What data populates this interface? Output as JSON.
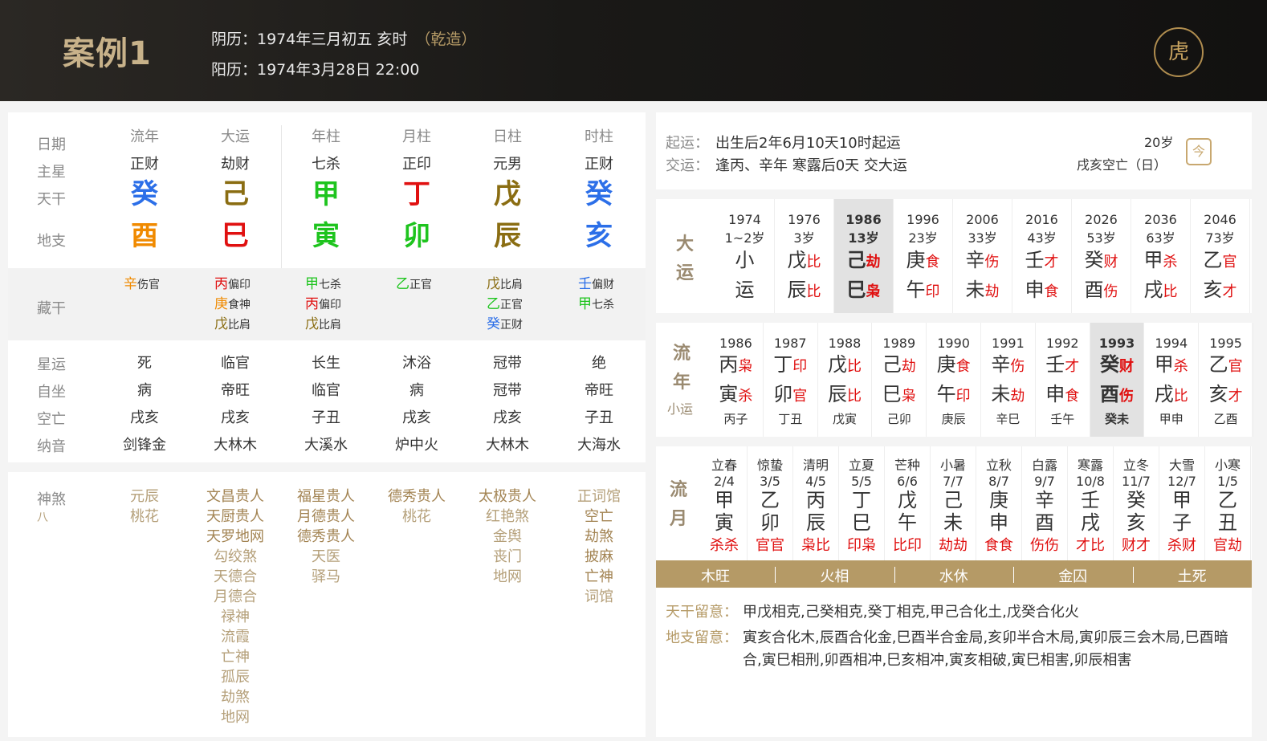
{
  "header": {
    "title": "案例1",
    "lunar": "阴历：1974年三月初五 亥时",
    "gender": "（乾造）",
    "solar": "阳历：1974年3月28日 22:00",
    "logo_icon": "tiger-seal-icon"
  },
  "pillars": {
    "col_headers": [
      "流年",
      "大运",
      "年柱",
      "月柱",
      "日柱",
      "时柱"
    ],
    "row_labels": {
      "date": "日期",
      "main_star": "主星",
      "tiangan": "天干",
      "dizhi": "地支",
      "canggan": "藏干",
      "xingyun": "星运",
      "zizuo": "自坐",
      "kongwang": "空亡",
      "nayin": "纳音",
      "shensha": "神煞",
      "shensha_sub": "八"
    },
    "main_star": [
      "正财",
      "劫财",
      "七杀",
      "正印",
      "元男",
      "正财"
    ],
    "tiangan": [
      {
        "char": "癸",
        "color": "#2c6fe8"
      },
      {
        "char": "己",
        "color": "#8a6d12"
      },
      {
        "char": "甲",
        "color": "#1ec41e"
      },
      {
        "char": "丁",
        "color": "#e01010"
      },
      {
        "char": "戊",
        "color": "#8a6d12"
      },
      {
        "char": "癸",
        "color": "#2c6fe8"
      }
    ],
    "dizhi": [
      {
        "char": "酉",
        "color": "#f08a00"
      },
      {
        "char": "巳",
        "color": "#e01010"
      },
      {
        "char": "寅",
        "color": "#1ec41e"
      },
      {
        "char": "卯",
        "color": "#1ec41e"
      },
      {
        "char": "辰",
        "color": "#8a6d12"
      },
      {
        "char": "亥",
        "color": "#2c6fe8"
      }
    ],
    "canggan": [
      [
        {
          "g": "辛",
          "c": "#f08a00",
          "s": "伤官"
        }
      ],
      [
        {
          "g": "丙",
          "c": "#e01010",
          "s": "偏印"
        },
        {
          "g": "庚",
          "c": "#f08a00",
          "s": "食神"
        },
        {
          "g": "戊",
          "c": "#8a6d12",
          "s": "比肩"
        }
      ],
      [
        {
          "g": "甲",
          "c": "#1ec41e",
          "s": "七杀"
        },
        {
          "g": "丙",
          "c": "#e01010",
          "s": "偏印"
        },
        {
          "g": "戊",
          "c": "#8a6d12",
          "s": "比肩"
        }
      ],
      [
        {
          "g": "乙",
          "c": "#1ec41e",
          "s": "正官"
        }
      ],
      [
        {
          "g": "戊",
          "c": "#8a6d12",
          "s": "比肩"
        },
        {
          "g": "乙",
          "c": "#1ec41e",
          "s": "正官"
        },
        {
          "g": "癸",
          "c": "#2c6fe8",
          "s": "正财"
        }
      ],
      [
        {
          "g": "壬",
          "c": "#2c6fe8",
          "s": "偏财"
        },
        {
          "g": "甲",
          "c": "#1ec41e",
          "s": "七杀"
        }
      ]
    ],
    "xingyun": [
      "死",
      "临官",
      "长生",
      "沐浴",
      "冠带",
      "绝"
    ],
    "zizuo": [
      "病",
      "帝旺",
      "临官",
      "病",
      "冠带",
      "帝旺"
    ],
    "kongwang": [
      "戌亥",
      "戌亥",
      "子丑",
      "戌亥",
      "戌亥",
      "子丑"
    ],
    "nayin": [
      "剑锋金",
      "大林木",
      "大溪水",
      "炉中火",
      "大林木",
      "大海水"
    ],
    "shensha": [
      [
        "元辰",
        "桃花"
      ],
      [
        "文昌贵人",
        "天厨贵人",
        "天罗地网",
        "勾绞煞",
        "天德合",
        "月德合",
        "禄神",
        "流霞",
        "亡神",
        "孤辰",
        "劫煞",
        "地网"
      ],
      [
        "福星贵人",
        "月德贵人",
        "德秀贵人",
        "天医",
        "驿马"
      ],
      [
        "德秀贵人",
        "桃花"
      ],
      [
        "太极贵人",
        "红艳煞",
        "金舆",
        "丧门",
        "地网"
      ],
      [
        "正词馆",
        "空亡",
        "劫煞",
        "披麻",
        "亡神",
        "词馆"
      ]
    ]
  },
  "right": {
    "qiyun_label": "起运：",
    "qiyun": "出生后2年6月10天10时起运",
    "jiaoyun_label": "交运：",
    "jiaoyun": "逢丙、辛年 寒露后0天 交大运",
    "age": "20岁",
    "kongwang": "戌亥空亡（日）",
    "calendar_icon": "calendar-today-icon",
    "dayun_side": [
      "大",
      "运"
    ],
    "liunian_side": [
      "流",
      "年"
    ],
    "xiaoyun_label": "小运",
    "liuyue_side": [
      "流",
      "月"
    ],
    "dayun": [
      {
        "year": "1974",
        "age": "1~2岁",
        "g": "小",
        "gs": "",
        "z": "运",
        "zs": ""
      },
      {
        "year": "1976",
        "age": "3岁",
        "g": "戊",
        "gs": "比",
        "z": "辰",
        "zs": "比"
      },
      {
        "year": "1986",
        "age": "13岁",
        "g": "己",
        "gs": "劫",
        "z": "巳",
        "zs": "枭"
      },
      {
        "year": "1996",
        "age": "23岁",
        "g": "庚",
        "gs": "食",
        "z": "午",
        "zs": "印"
      },
      {
        "year": "2006",
        "age": "33岁",
        "g": "辛",
        "gs": "伤",
        "z": "未",
        "zs": "劫"
      },
      {
        "year": "2016",
        "age": "43岁",
        "g": "壬",
        "gs": "才",
        "z": "申",
        "zs": "食"
      },
      {
        "year": "2026",
        "age": "53岁",
        "g": "癸",
        "gs": "财",
        "z": "酉",
        "zs": "伤"
      },
      {
        "year": "2036",
        "age": "63岁",
        "g": "甲",
        "gs": "杀",
        "z": "戌",
        "zs": "比"
      },
      {
        "year": "2046",
        "age": "73岁",
        "g": "乙",
        "gs": "官",
        "z": "亥",
        "zs": "才"
      }
    ],
    "liunian": [
      {
        "year": "1986",
        "g": "丙",
        "gs": "枭",
        "z": "寅",
        "zs": "杀",
        "xy": "丙子"
      },
      {
        "year": "1987",
        "g": "丁",
        "gs": "印",
        "z": "卯",
        "zs": "官",
        "xy": "丁丑"
      },
      {
        "year": "1988",
        "g": "戊",
        "gs": "比",
        "z": "辰",
        "zs": "比",
        "xy": "戊寅"
      },
      {
        "year": "1989",
        "g": "己",
        "gs": "劫",
        "z": "巳",
        "zs": "枭",
        "xy": "己卯"
      },
      {
        "year": "1990",
        "g": "庚",
        "gs": "食",
        "z": "午",
        "zs": "印",
        "xy": "庚辰"
      },
      {
        "year": "1991",
        "g": "辛",
        "gs": "伤",
        "z": "未",
        "zs": "劫",
        "xy": "辛巳"
      },
      {
        "year": "1992",
        "g": "壬",
        "gs": "才",
        "z": "申",
        "zs": "食",
        "xy": "壬午"
      },
      {
        "year": "1993",
        "g": "癸",
        "gs": "财",
        "z": "酉",
        "zs": "伤",
        "xy": "癸未"
      },
      {
        "year": "1994",
        "g": "甲",
        "gs": "杀",
        "z": "戌",
        "zs": "比",
        "xy": "甲申"
      },
      {
        "year": "1995",
        "g": "乙",
        "gs": "官",
        "z": "亥",
        "zs": "才",
        "xy": "乙酉"
      }
    ],
    "liuyue": [
      {
        "jq": "立春",
        "d": "2/4",
        "g": "甲",
        "z": "寅",
        "s": "杀杀"
      },
      {
        "jq": "惊蛰",
        "d": "3/5",
        "g": "乙",
        "z": "卯",
        "s": "官官"
      },
      {
        "jq": "清明",
        "d": "4/5",
        "g": "丙",
        "z": "辰",
        "s": "枭比"
      },
      {
        "jq": "立夏",
        "d": "5/5",
        "g": "丁",
        "z": "巳",
        "s": "印枭"
      },
      {
        "jq": "芒种",
        "d": "6/6",
        "g": "戊",
        "z": "午",
        "s": "比印"
      },
      {
        "jq": "小暑",
        "d": "7/7",
        "g": "己",
        "z": "未",
        "s": "劫劫"
      },
      {
        "jq": "立秋",
        "d": "8/7",
        "g": "庚",
        "z": "申",
        "s": "食食"
      },
      {
        "jq": "白露",
        "d": "9/7",
        "g": "辛",
        "z": "酉",
        "s": "伤伤"
      },
      {
        "jq": "寒露",
        "d": "10/8",
        "g": "壬",
        "z": "戌",
        "s": "才比"
      },
      {
        "jq": "立冬",
        "d": "11/7",
        "g": "癸",
        "z": "亥",
        "s": "财才"
      },
      {
        "jq": "大雪",
        "d": "12/7",
        "g": "甲",
        "z": "子",
        "s": "杀财"
      },
      {
        "jq": "小寒",
        "d": "1/5",
        "g": "乙",
        "z": "丑",
        "s": "官劫"
      }
    ],
    "wuxing": [
      "木旺",
      "火相",
      "水休",
      "金囚",
      "土死"
    ],
    "tiangan_note_label": "天干留意：",
    "tiangan_note": "甲戊相克,己癸相克,癸丁相克,甲己合化土,戊癸合化火",
    "dizhi_note_label": "地支留意：",
    "dizhi_note_1": "寅亥合化木,辰酉合化金,巳酉半合金局,亥卯半合木局,寅卯辰三会木局,巳酉暗",
    "dizhi_note_2": "合,寅巳相刑,卯酉相冲,巳亥相冲,寅亥相破,寅巳相害,卯辰相害"
  }
}
